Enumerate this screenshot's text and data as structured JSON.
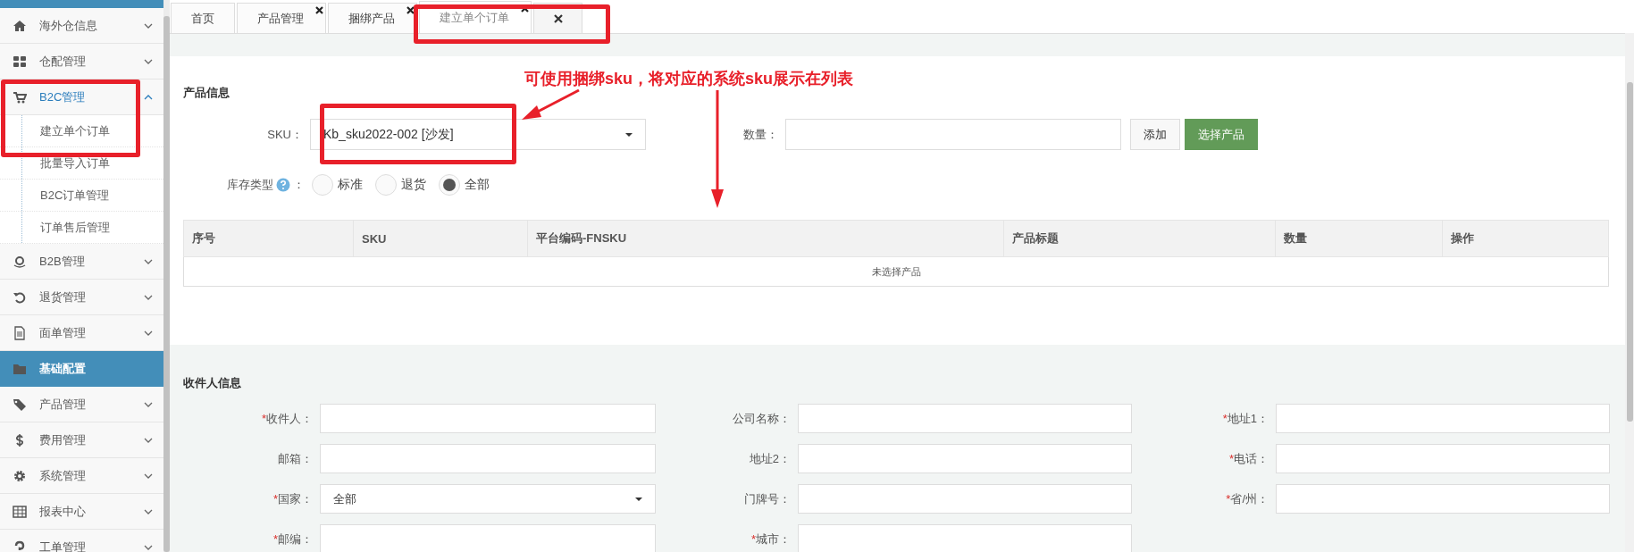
{
  "sidebar": {
    "items": [
      {
        "kind": "menu",
        "label": "海外仓信息",
        "expanded": false
      },
      {
        "kind": "menu",
        "label": "仓配管理",
        "expanded": false
      },
      {
        "kind": "menu",
        "label": "B2C管理",
        "expanded": true,
        "children": [
          {
            "label": "建立单个订单"
          },
          {
            "label": "批量导入订单"
          },
          {
            "label": "B2C订单管理"
          },
          {
            "label": "订单售后管理"
          }
        ]
      },
      {
        "kind": "menu",
        "label": "B2B管理",
        "expanded": false
      },
      {
        "kind": "menu",
        "label": "退货管理",
        "expanded": false
      },
      {
        "kind": "menu",
        "label": "面单管理",
        "expanded": false
      },
      {
        "kind": "header",
        "label": "基础配置"
      },
      {
        "kind": "menu",
        "label": "产品管理",
        "expanded": false
      },
      {
        "kind": "menu",
        "label": "费用管理",
        "expanded": false
      },
      {
        "kind": "menu",
        "label": "系统管理",
        "expanded": false
      },
      {
        "kind": "menu",
        "label": "报表中心",
        "expanded": false
      },
      {
        "kind": "menu",
        "label": "工单管理",
        "expanded": false
      }
    ]
  },
  "tabs": [
    {
      "label": "首页",
      "closable": false,
      "selected": false
    },
    {
      "label": "产品管理",
      "closable": true,
      "selected": false
    },
    {
      "label": "捆绑产品",
      "closable": true,
      "selected": false
    },
    {
      "label": "建立单个订单",
      "closable": true,
      "selected": true
    }
  ],
  "product_info": {
    "title": "产品信息",
    "sku": {
      "label": "SKU：",
      "value": "Kb_sku2022-002 [沙发]"
    },
    "quantity": {
      "label": "数量："
    },
    "buttons": [
      {
        "kind": "default",
        "label": "添加"
      },
      {
        "kind": "primary",
        "label": "选择产品"
      }
    ],
    "stock_type": {
      "label": "库存类型",
      "colon": "：",
      "options": [
        {
          "label": "标准",
          "selected": false
        },
        {
          "label": "退货",
          "selected": false
        },
        {
          "label": "全部",
          "selected": true
        }
      ]
    },
    "table": {
      "columns": [
        "序号",
        "SKU",
        "平台编码-FNSKU",
        "产品标题",
        "数量",
        "操作"
      ],
      "empty_message": "未选择产品"
    }
  },
  "receiver_info": {
    "title": "收件人信息",
    "required_mark": "*",
    "fields": [
      {
        "kind": "text",
        "label": "收件人：",
        "required": true
      },
      {
        "kind": "text",
        "label": "公司名称：",
        "required": false
      },
      {
        "kind": "text",
        "label": "地址1：",
        "required": true
      },
      {
        "kind": "text",
        "label": "邮箱：",
        "required": false
      },
      {
        "kind": "text",
        "label": "地址2：",
        "required": false
      },
      {
        "kind": "text",
        "label": "电话：",
        "required": true
      },
      {
        "kind": "select",
        "label": "国家：",
        "required": true,
        "value": "全部"
      },
      {
        "kind": "text",
        "label": "门牌号：",
        "required": false
      },
      {
        "kind": "text",
        "label": "省/州：",
        "required": true
      },
      {
        "kind": "text",
        "label": "邮编：",
        "required": true
      },
      {
        "kind": "text",
        "label": "城市：",
        "required": true
      }
    ]
  },
  "annotation": {
    "note": "可使用捆绑sku，将对应的系统sku展示在列表"
  }
}
